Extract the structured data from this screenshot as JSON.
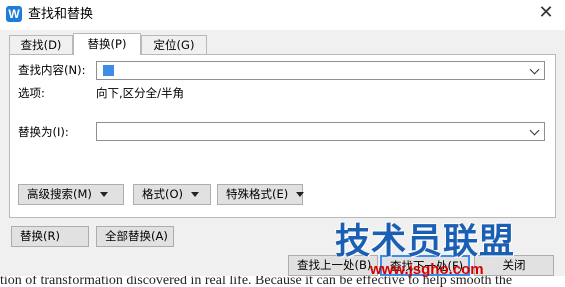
{
  "window": {
    "title": "查找和替换",
    "app_icon_letter": "W",
    "close_glyph": "✕"
  },
  "tabs": [
    {
      "label": "查找(D)",
      "active": false
    },
    {
      "label": "替换(P)",
      "active": true
    },
    {
      "label": "定位(G)",
      "active": false
    }
  ],
  "find": {
    "label": "查找内容(N):",
    "value": ""
  },
  "options": {
    "label": "选项:",
    "value": "向下,区分全/半角"
  },
  "replace": {
    "label": "替换为(I):",
    "value": ""
  },
  "buttons": {
    "advanced_search": "高级搜索(M)",
    "format": "格式(O)",
    "special_format": "特殊格式(E)",
    "replace": "替换(R)",
    "replace_all": "全部替换(A)",
    "find_previous": "查找上一处(B)",
    "find_next": "查找下一处(F)",
    "close": "关闭"
  },
  "watermark": {
    "logo_text": "技术员联盟",
    "url": "www.jsgho.com",
    "background_text": "tion of transformation discovered in real life. Because it can be effective to help smooth the"
  },
  "colors": {
    "accent": "#1e7dd8",
    "caret": "#3c8ce8",
    "dialog_bg": "#f0f0f0",
    "watermark_logo": "#1a5fb4",
    "watermark_url": "#d40000"
  }
}
